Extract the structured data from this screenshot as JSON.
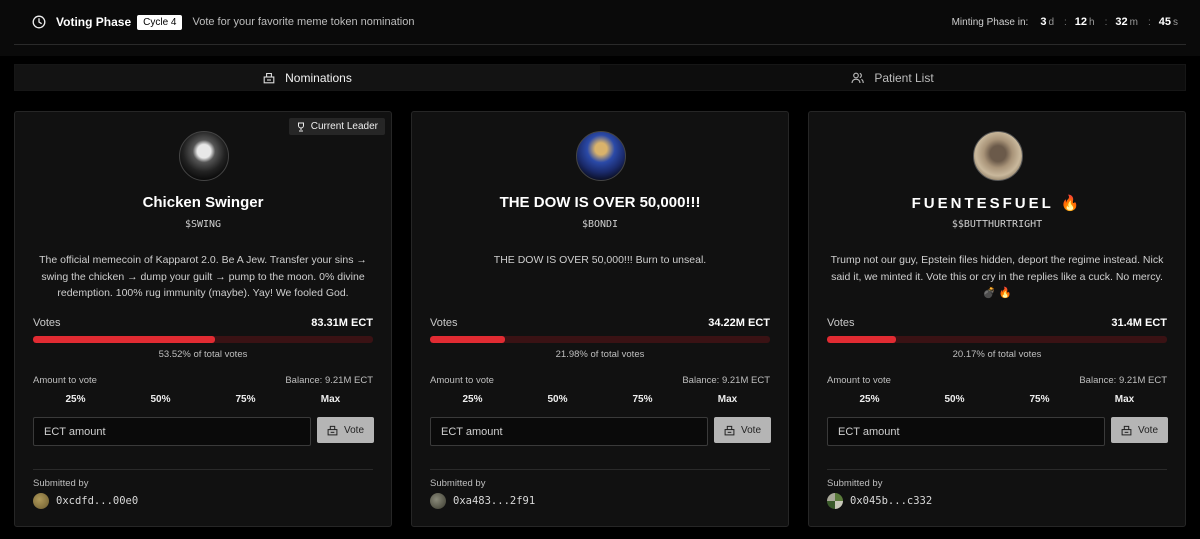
{
  "header": {
    "icon": "clock-icon",
    "phase": "Voting Phase",
    "cycle": "Cycle 4",
    "subtitle": "Vote for your favorite meme token nomination",
    "minting_label": "Minting Phase in:",
    "countdown": {
      "days": "3",
      "days_unit": "d",
      "hours": "12",
      "hours_unit": "h",
      "minutes": "32",
      "minutes_unit": "m",
      "seconds": "45",
      "seconds_unit": "s"
    }
  },
  "tabs": [
    {
      "label": "Nominations",
      "icon": "ballot-box-icon",
      "active": true
    },
    {
      "label": "Patient List",
      "icon": "users-icon",
      "active": false
    }
  ],
  "cards": [
    {
      "leader_badge": "Current Leader",
      "title": "Chicken Swinger",
      "ticker": "$SWING",
      "description": "The official memecoin of Kapparot 2.0. Be A Jew. Transfer your sins → swing the chicken → dump your guilt → pump to the moon. 0% divine redemption. 100% rug immunity (maybe). Yay! We fooled God.",
      "votes_label": "Votes",
      "votes_value": "83.31M ECT",
      "vote_share": 0.5352,
      "pct_text": "53.52% of total votes",
      "amount_label": "Amount to vote",
      "balance": "Balance: 9.21M ECT",
      "quick": [
        "25%",
        "50%",
        "75%",
        "Max"
      ],
      "input_placeholder": "ECT amount",
      "vote_label": "Vote",
      "submitted_label": "Submitted by",
      "address": "0xcdfd...00e0"
    },
    {
      "title": "THE DOW IS OVER 50,000!!!",
      "ticker": "$BONDI",
      "description": "THE DOW IS OVER 50,000!!! Burn to unseal.",
      "votes_label": "Votes",
      "votes_value": "34.22M ECT",
      "vote_share": 0.2198,
      "pct_text": "21.98% of total votes",
      "amount_label": "Amount to vote",
      "balance": "Balance: 9.21M ECT",
      "quick": [
        "25%",
        "50%",
        "75%",
        "Max"
      ],
      "input_placeholder": "ECT amount",
      "vote_label": "Vote",
      "submitted_label": "Submitted by",
      "address": "0xa483...2f91"
    },
    {
      "title": "FUENTESFUEL 🔥",
      "ticker": "$$BUTTHURTRIGHT",
      "description": "Trump not our guy, Epstein files hidden, deport the regime instead. Nick said it, we minted it. Vote this or cry in the replies like a cuck. No mercy. 💣 🔥",
      "votes_label": "Votes",
      "votes_value": "31.4M ECT",
      "vote_share": 0.2017,
      "pct_text": "20.17% of total votes",
      "amount_label": "Amount to vote",
      "balance": "Balance: 9.21M ECT",
      "quick": [
        "25%",
        "50%",
        "75%",
        "Max"
      ],
      "input_placeholder": "ECT amount",
      "vote_label": "Vote",
      "submitted_label": "Submitted by",
      "address": "0x045b...c332"
    }
  ],
  "colors": {
    "accent": "#e12b32",
    "bar_track": "#3a1214",
    "card_bg": "#111111",
    "page_bg": "#000000"
  }
}
